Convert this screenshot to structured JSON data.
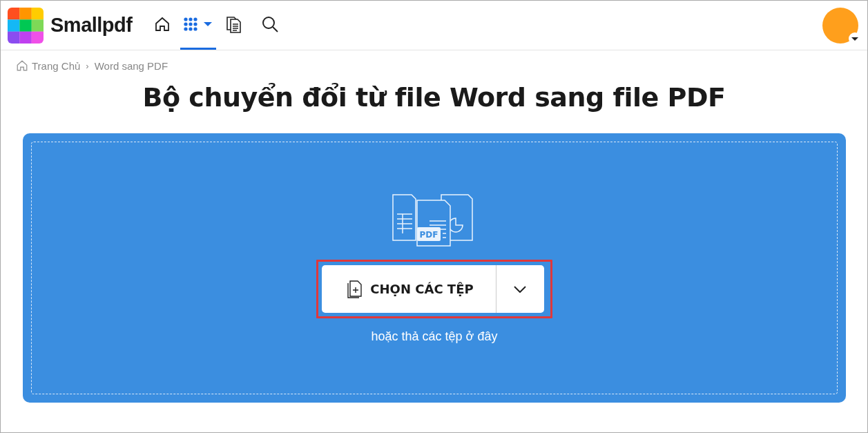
{
  "header": {
    "brand": "Smallpdf",
    "nav": [
      {
        "kind": "home",
        "selected": false
      },
      {
        "kind": "apps",
        "selected": true
      },
      {
        "kind": "documents",
        "selected": false
      },
      {
        "kind": "search",
        "selected": false
      }
    ]
  },
  "breadcrumb": [
    "Trang Chủ",
    "Word sang PDF"
  ],
  "breadcrumb_separator": "›",
  "title": "Bộ chuyển đổi từ file Word sang file PDF",
  "dropzone": {
    "illustration_label": "PDF",
    "button": "CHỌN CÁC TỆP",
    "hint": "hoặc thả các tệp ở đây"
  }
}
